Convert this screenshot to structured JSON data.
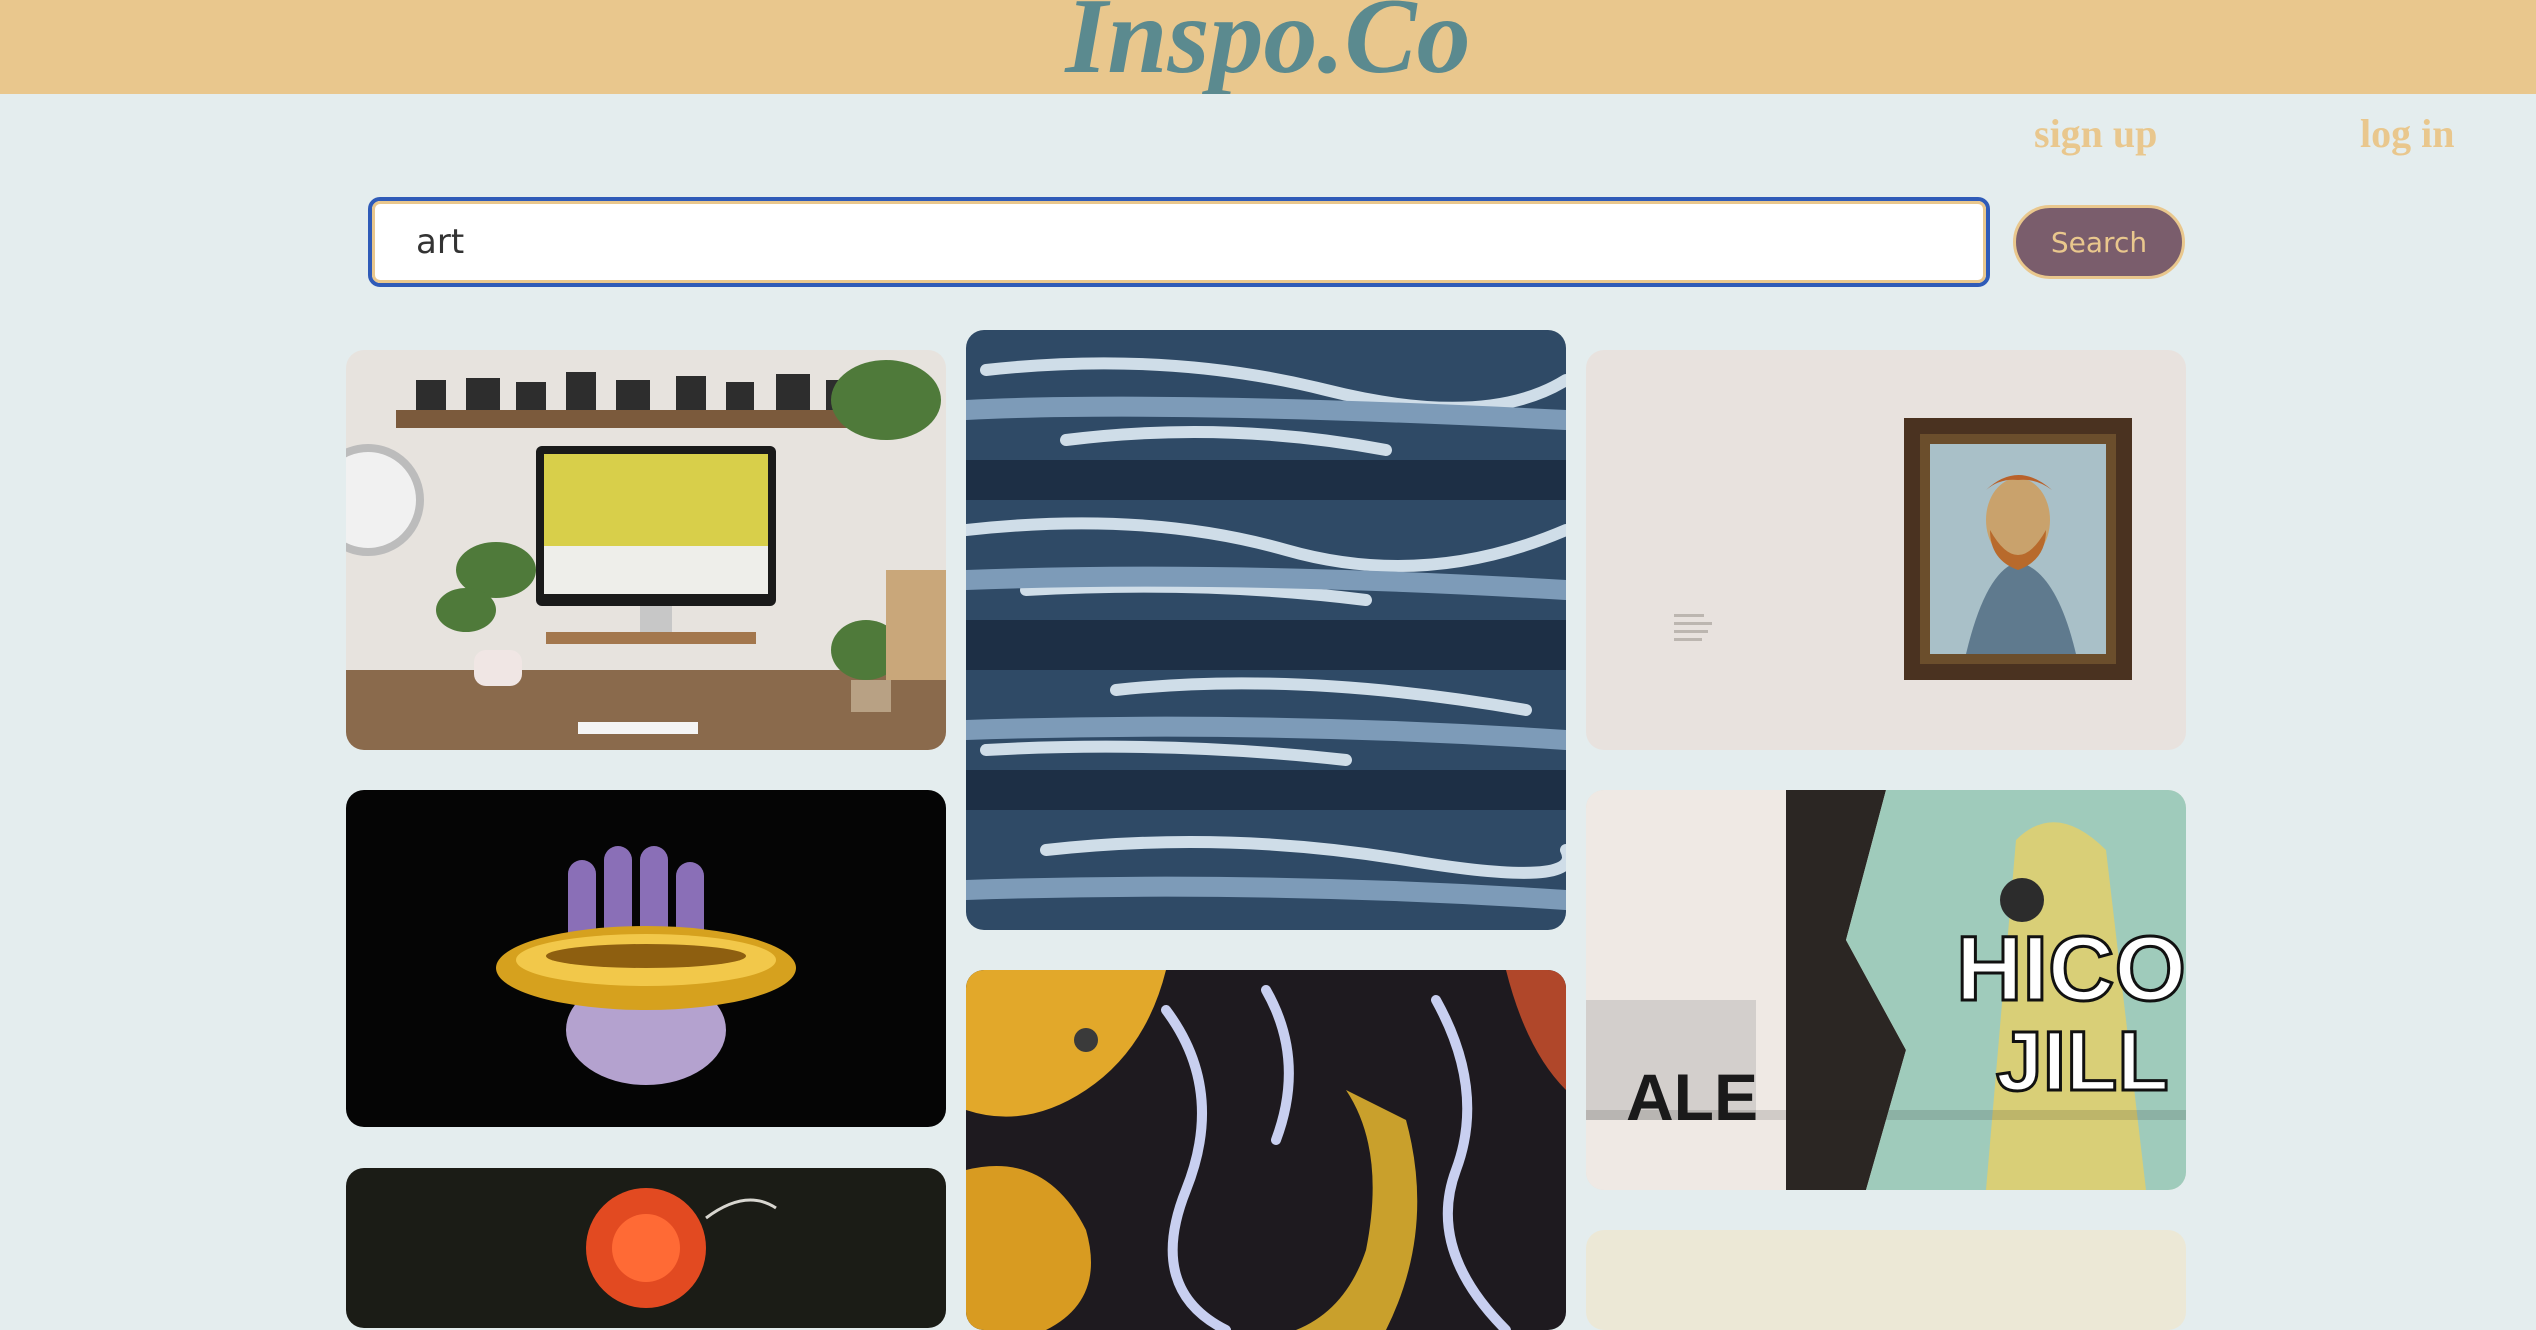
{
  "header": {
    "logo_text": "Inspo.Co",
    "background": "#e9c78d",
    "logo_color": "#5b8a8f"
  },
  "nav": {
    "signup_label": "sign up",
    "login_label": "log in"
  },
  "search": {
    "value": "art",
    "button_label": "Search"
  },
  "gallery": {
    "images": [
      {
        "name": "desk-workspace-image"
      },
      {
        "name": "blue-abstract-painting-image"
      },
      {
        "name": "van-gogh-portrait-image"
      },
      {
        "name": "chrome-hand-image"
      },
      {
        "name": "fluid-art-image"
      },
      {
        "name": "poster-collage-image"
      },
      {
        "name": "red-flower-image"
      },
      {
        "name": "cream-image"
      }
    ],
    "collage_texts": [
      "HICO",
      "JILL",
      "ALE"
    ]
  }
}
